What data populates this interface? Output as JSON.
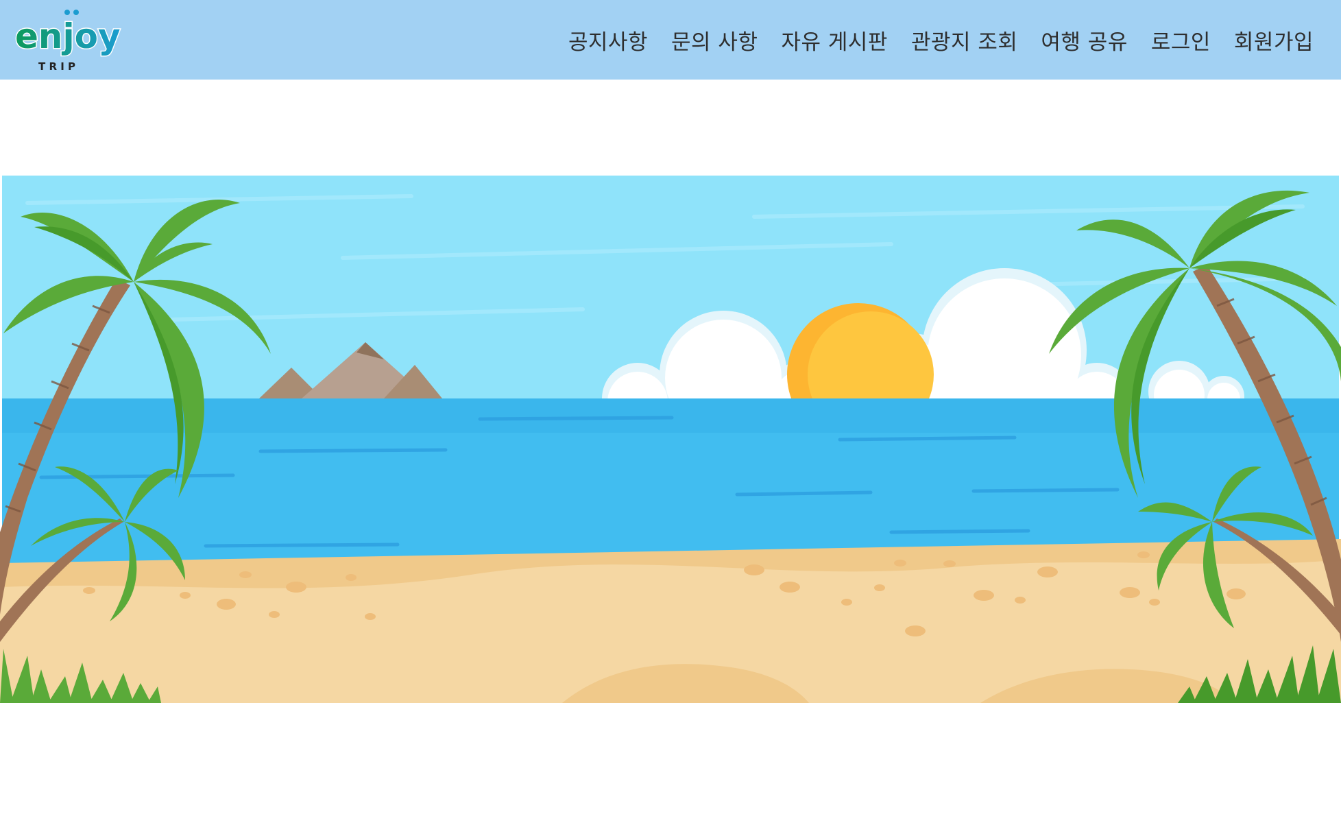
{
  "header": {
    "logo": {
      "text": "enjoy",
      "subtext": "T R I P"
    },
    "nav": [
      {
        "id": "notice",
        "label": "공지사항"
      },
      {
        "id": "inquiry",
        "label": "문의 사항"
      },
      {
        "id": "free-board",
        "label": "자유 게시판"
      },
      {
        "id": "attractions",
        "label": "관광지 조회"
      },
      {
        "id": "travel-share",
        "label": "여행 공유"
      },
      {
        "id": "login",
        "label": "로그인"
      },
      {
        "id": "signup",
        "label": "회원가입"
      }
    ]
  },
  "colors": {
    "header_bg": "#a2d1f3",
    "logo_green": "#0e9a5c",
    "logo_teal": "#1b9cd0",
    "sky": "#8fe3fa",
    "sea": "#41bdf0",
    "sand": "#f5d7a3",
    "sun": "#fec13f",
    "palm_leaf": "#5aaa39",
    "palm_trunk": "#a07456"
  }
}
